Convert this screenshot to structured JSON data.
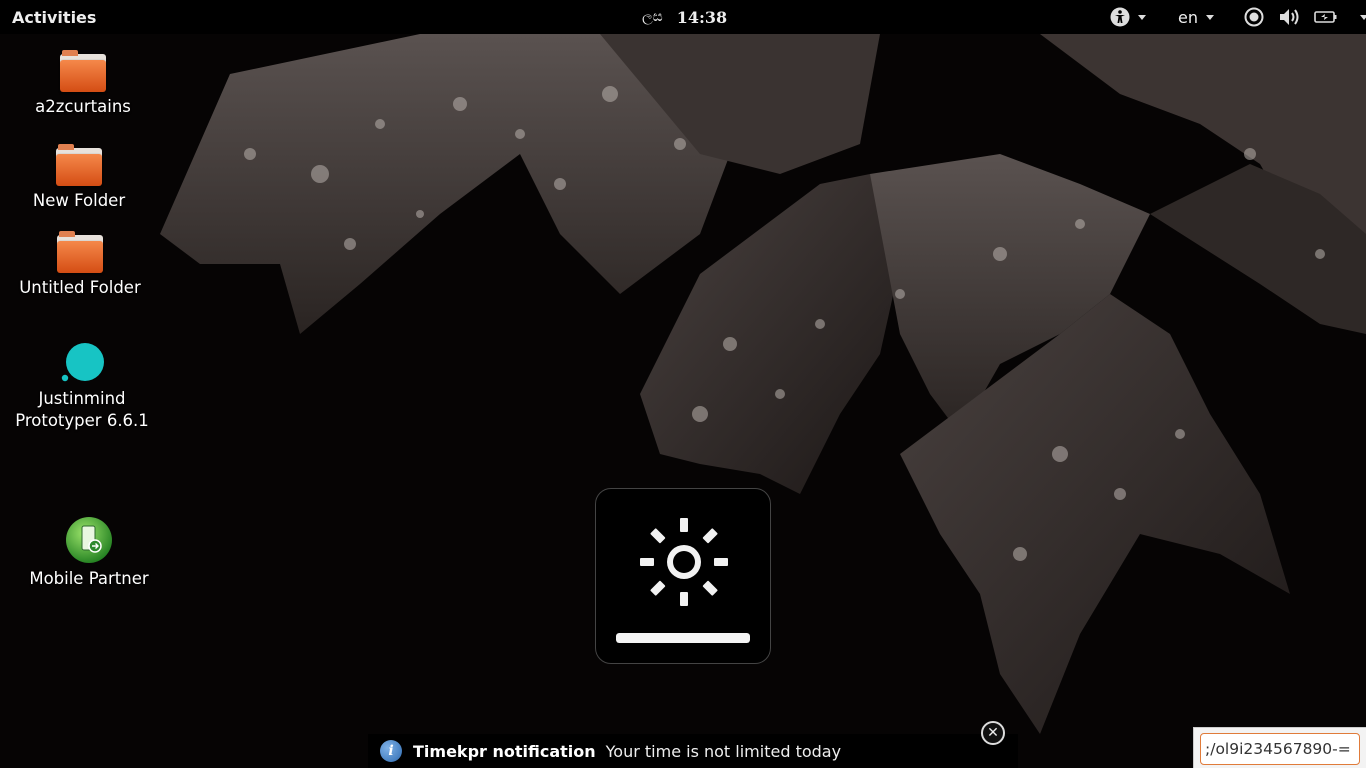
{
  "topbar": {
    "activities_label": "Activities",
    "clock_language": "ලස",
    "clock_time": "14:38",
    "accessibility_icon": "accessibility-icon",
    "input_language": "en",
    "system_icons": [
      "brightness-icon",
      "volume-icon",
      "battery-icon"
    ]
  },
  "desktop": {
    "icons": [
      {
        "label": "a2zcurtains",
        "icon": "folder-icon"
      },
      {
        "label": "New Folder",
        "icon": "folder-icon"
      },
      {
        "label": "Untitled Folder",
        "icon": "folder-icon"
      },
      {
        "label_line1": "Justinmind",
        "label_line2": "Prototyper 6.6.1",
        "icon": "justinmind-icon"
      },
      {
        "label": "Mobile Partner",
        "icon": "mobile-partner-icon"
      }
    ]
  },
  "osd": {
    "icon": "brightness-icon",
    "level": 1.0
  },
  "notification": {
    "icon": "info-icon",
    "title": "Timekpr notification",
    "body": "Your time is not limited today"
  },
  "text_box": {
    "value": ";/ol9i234567890-="
  },
  "colors": {
    "folder_orange": "#f26b2a",
    "justinmind_teal": "#17c4c4",
    "mobile_partner_green": "#3aa63a",
    "text_field_focus": "#e07b3a"
  }
}
